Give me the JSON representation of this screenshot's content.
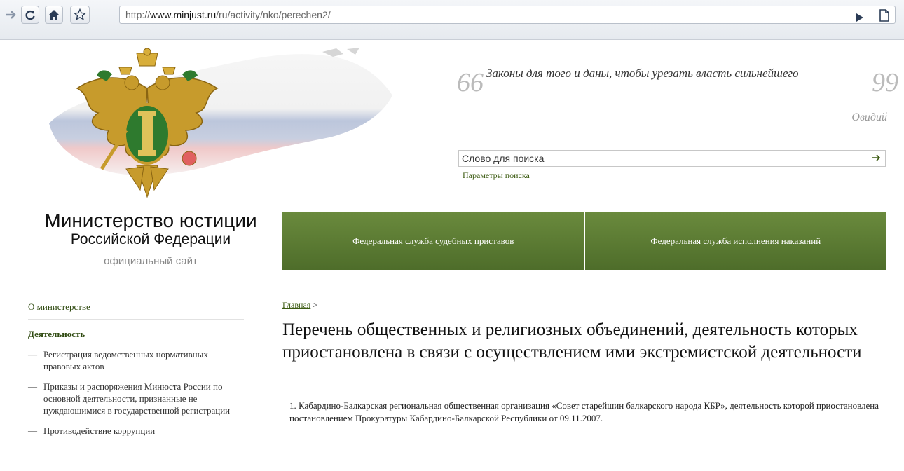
{
  "browser": {
    "url_prefix": "http://",
    "url_domain": "www.minjust.ru",
    "url_path": "/ru/activity/nko/perechen2/"
  },
  "site": {
    "title_line1": "Министерство юстиции",
    "title_line2": "Российской Федерации",
    "tagline": "официальный сайт"
  },
  "quote": {
    "text": "Законы для того и даны, чтобы урезать власть сильнейшего",
    "author": "Овидий",
    "open_mark": "66",
    "close_mark": "99"
  },
  "search": {
    "placeholder": "Слово для поиска",
    "params_label": "Параметры поиска"
  },
  "nav": {
    "items": [
      {
        "label": "Федеральная служба судебных приставов"
      },
      {
        "label": "Федеральная служба исполнения наказаний"
      }
    ]
  },
  "sidebar": {
    "top": "О министерстве",
    "active": "Деятельность",
    "dash": "—",
    "items": [
      {
        "label": "Регистрация ведомственных нормативных правовых актов"
      },
      {
        "label": "Приказы и распоряжения Минюста России по основной деятельности, признанные не нуждающимися в государственной регистрации"
      },
      {
        "label": "Противодействие коррупции"
      }
    ]
  },
  "breadcrumb": {
    "home": "Главная",
    "separator": ">"
  },
  "main": {
    "title": "Перечень общественных и религиозных объединений, деятельность которых приостановлена в связи с осуществлением ими экстремистской деятельности",
    "items": [
      {
        "text": "1. Кабардино-Балкарская региональная общественная организация «Совет старейшин балкарского народа КБР», деятельность которой приостановлена постановлением Прокуратуры Кабардино-Балкарской Республики от 09.11.2007."
      }
    ]
  },
  "colors": {
    "nav_green": "#5a7a33",
    "link_green": "#3c5b12"
  },
  "icons": [
    "forward-icon",
    "reload-icon",
    "home-icon",
    "bookmark-star-icon",
    "go-icon",
    "page-icon",
    "search-arrow-icon",
    "emblem-icon"
  ]
}
